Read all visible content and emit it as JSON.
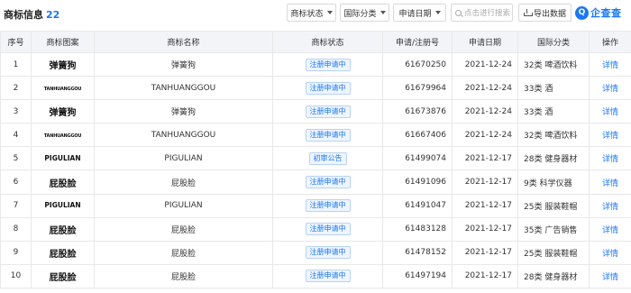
{
  "header": {
    "title": "商标信息",
    "count": "22",
    "filters": [
      {
        "label": "商标状态"
      },
      {
        "label": "国际分类"
      },
      {
        "label": "申请日期"
      }
    ],
    "search_placeholder": "点击进行搜索",
    "export_label": "导出数据",
    "logo_text": "企查查"
  },
  "table": {
    "columns": [
      "序号",
      "商标图案",
      "商标名称",
      "商标状态",
      "申请/注册号",
      "申请日期",
      "国际分类",
      "操作"
    ],
    "rows": [
      {
        "index": "1",
        "image": "弹簧狗",
        "name": "弹簧狗",
        "status": "注册申请中",
        "reg_no": "61670250",
        "date": "2021-12-24",
        "class": "32类 啤酒饮料",
        "action": "详情"
      },
      {
        "index": "2",
        "image": "TANHUANGGOU",
        "name": "TANHUANGGOU",
        "status": "注册申请中",
        "reg_no": "61679964",
        "date": "2021-12-24",
        "class": "33类 酒",
        "action": "详情"
      },
      {
        "index": "3",
        "image": "弹簧狗",
        "name": "弹簧狗",
        "status": "注册申请中",
        "reg_no": "61673876",
        "date": "2021-12-24",
        "class": "33类 酒",
        "action": "详情"
      },
      {
        "index": "4",
        "image": "TANHUANGGOU",
        "name": "TANHUANGGOU",
        "status": "注册申请中",
        "reg_no": "61667406",
        "date": "2021-12-24",
        "class": "32类 啤酒饮料",
        "action": "详情"
      },
      {
        "index": "5",
        "image": "PIGULIAN",
        "name": "PIGULIAN",
        "status": "初审公告",
        "reg_no": "61499074",
        "date": "2021-12-17",
        "class": "28类 健身器材",
        "action": "详情"
      },
      {
        "index": "6",
        "image": "屁股脸",
        "name": "屁股脸",
        "status": "注册申请中",
        "reg_no": "61491096",
        "date": "2021-12-17",
        "class": "9类 科学仪器",
        "action": "详情"
      },
      {
        "index": "7",
        "image": "PIGULIAN",
        "name": "PIGULIAN",
        "status": "注册申请中",
        "reg_no": "61491047",
        "date": "2021-12-17",
        "class": "25类 服装鞋帽",
        "action": "详情"
      },
      {
        "index": "8",
        "image": "屁股脸",
        "name": "屁股脸",
        "status": "注册申请中",
        "reg_no": "61483128",
        "date": "2021-12-17",
        "class": "35类 广告销售",
        "action": "详情"
      },
      {
        "index": "9",
        "image": "屁股脸",
        "name": "屁股脸",
        "status": "注册申请中",
        "reg_no": "61478152",
        "date": "2021-12-17",
        "class": "25类 服装鞋帽",
        "action": "详情"
      },
      {
        "index": "10",
        "image": "屁股脸",
        "name": "屁股脸",
        "status": "注册申请中",
        "reg_no": "61497194",
        "date": "2021-12-17",
        "class": "28类 健身器材",
        "action": "详情"
      }
    ]
  },
  "colors": {
    "accent": "#1677ff",
    "header_bg": "#f2f4f8",
    "border": "#e8e8e8"
  }
}
